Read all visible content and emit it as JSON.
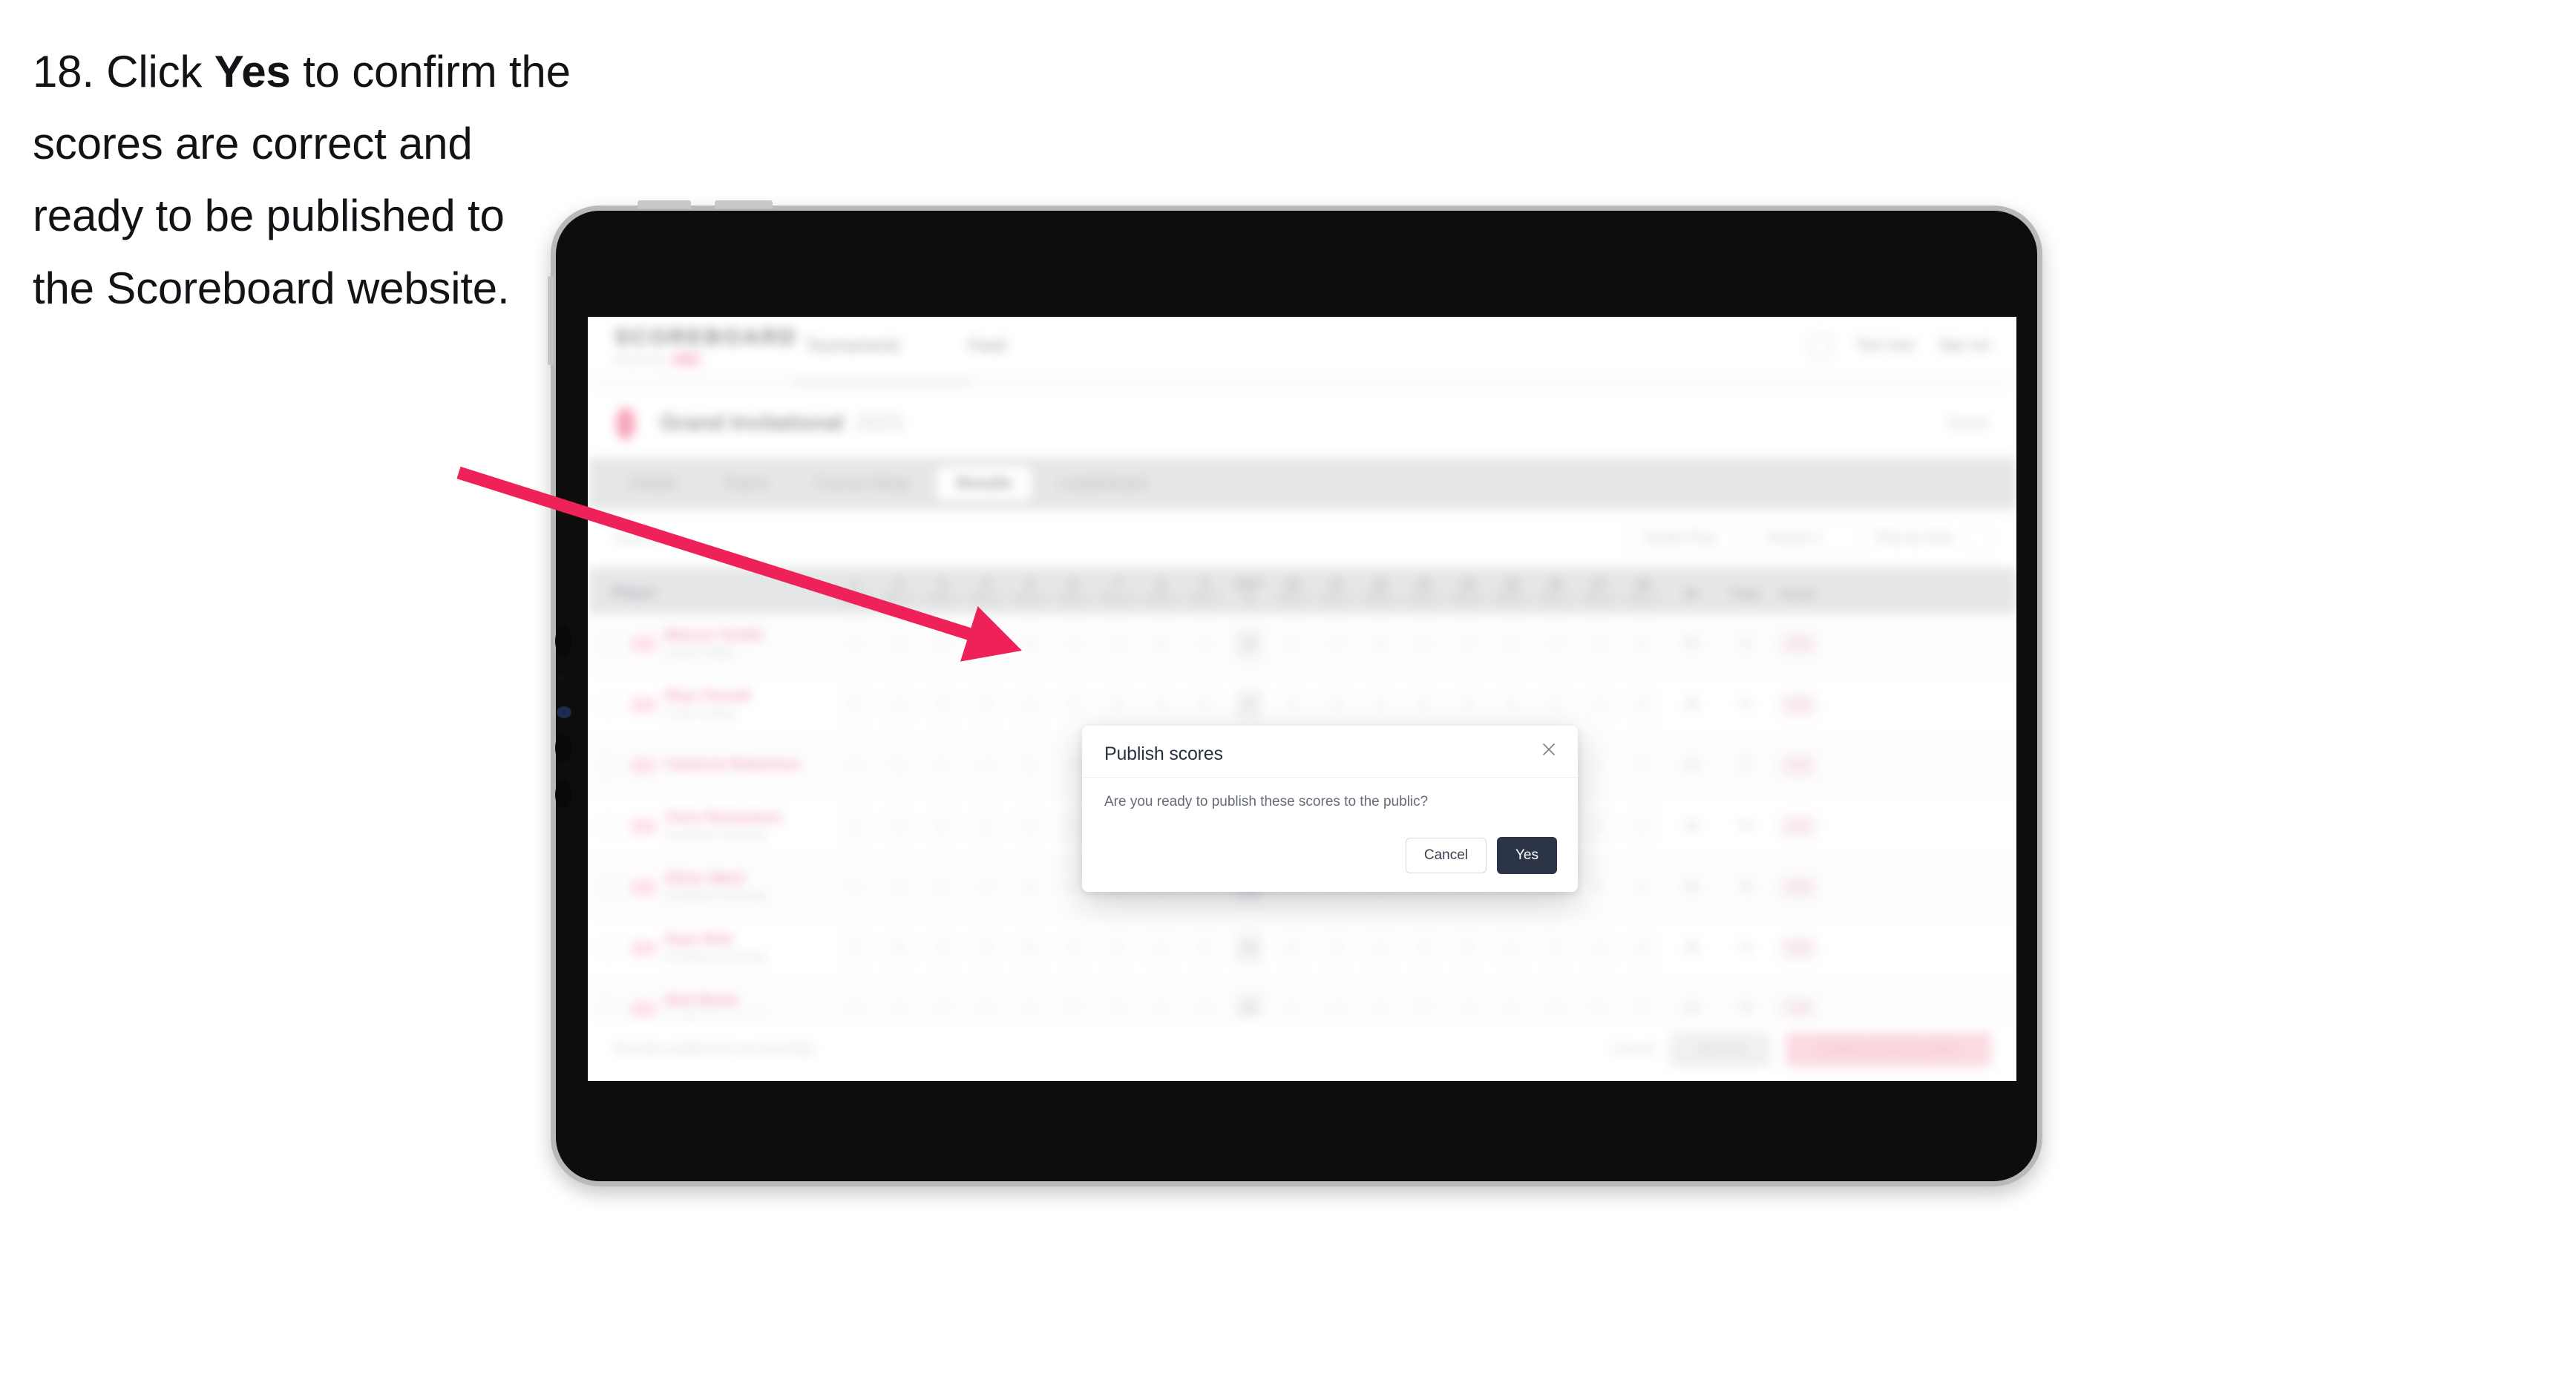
{
  "caption": {
    "prefix": "18. Click ",
    "emphasis": "Yes",
    "suffix": " to confirm the scores are correct and ready to be published to the Scoreboard website."
  },
  "annotation": {
    "type": "arrow",
    "color": "#ee2259",
    "points_to": "yes-button"
  },
  "device": {
    "kind": "tablet",
    "frame_color": "#0d0d0d",
    "bezel_color": "#b9b9b9"
  },
  "app": {
    "header": {
      "logo": "SCOREBOARD",
      "logo_sub": "Powered by",
      "logo_badge": "XYZ",
      "nav": [
        {
          "label": "Tournaments"
        },
        {
          "label": "Feed"
        }
      ],
      "user_name": "Test User",
      "sign_out": "Sign out"
    },
    "event": {
      "name": "Grand Invitational",
      "year": "2023",
      "right_action": "Event"
    },
    "tabs": [
      {
        "label": "Details",
        "active": false
      },
      {
        "label": "Teams",
        "active": false
      },
      {
        "label": "Course Setup",
        "active": false
      },
      {
        "label": "Results",
        "active": true
      },
      {
        "label": "Leaderboard",
        "active": false
      }
    ],
    "filters": {
      "search_placeholder": "Search",
      "round_select": "Round 1",
      "view_select": "Stroke Play",
      "play_select": "Play by hole"
    },
    "table": {
      "player_header": "Player",
      "hole_headers": [
        {
          "num": "1",
          "par": "PAR 4"
        },
        {
          "num": "2",
          "par": "PAR 4"
        },
        {
          "num": "3",
          "par": "PAR 3"
        },
        {
          "num": "4",
          "par": "PAR 5"
        },
        {
          "num": "5",
          "par": "PAR 4"
        },
        {
          "num": "6",
          "par": "PAR 4"
        },
        {
          "num": "7",
          "par": "PAR 3"
        },
        {
          "num": "8",
          "par": "PAR 4"
        },
        {
          "num": "9",
          "par": "PAR 5"
        },
        {
          "num": "OUT",
          "par": "36"
        },
        {
          "num": "10",
          "par": "PAR 4"
        },
        {
          "num": "11",
          "par": "PAR 4"
        },
        {
          "num": "12",
          "par": "PAR 3"
        },
        {
          "num": "13",
          "par": "PAR 5"
        },
        {
          "num": "14",
          "par": "PAR 4"
        },
        {
          "num": "15",
          "par": "PAR 4"
        },
        {
          "num": "16",
          "par": "PAR 3"
        },
        {
          "num": "17",
          "par": "PAR 4"
        },
        {
          "num": "18",
          "par": "PAR 5"
        }
      ],
      "tail_headers": [
        "IN",
        "Total",
        "Score"
      ],
      "rows": [
        {
          "name": "Marcus Tomlin",
          "team": "Coast College",
          "scores": [
            "4",
            "4",
            "3",
            "4",
            "5",
            "4",
            "3",
            "5",
            "4",
            "36",
            "4",
            "4",
            "3",
            "5",
            "4",
            "4",
            "3",
            "4",
            "5"
          ],
          "in": "36",
          "total": "72",
          "score": "+0"
        },
        {
          "name": "Rhys Parnell",
          "team": "Coast College",
          "scores": [
            "5",
            "4",
            "3",
            "4",
            "4",
            "5",
            "3",
            "4",
            "5",
            "37",
            "4",
            "5",
            "3",
            "5",
            "4",
            "4",
            "4",
            "4",
            "5"
          ],
          "in": "38",
          "total": "75",
          "score": "+3"
        },
        {
          "name": "Cameron Robertson",
          "team": "",
          "scores": [
            "4",
            "5",
            "4",
            "4",
            "5",
            "4",
            "3",
            "4",
            "5",
            "38",
            "5",
            "4",
            "3",
            "5",
            "5",
            "4",
            "3",
            "5",
            "5"
          ],
          "in": "39",
          "total": "77",
          "score": "+5"
        },
        {
          "name": "Chris Richardson",
          "team": "Southland University",
          "scores": [
            "4",
            "4",
            "3",
            "5",
            "4",
            "4",
            "3",
            "4",
            "5",
            "36",
            "4",
            "4",
            "4",
            "5",
            "4",
            "5",
            "3",
            "4",
            "5"
          ],
          "in": "38",
          "total": "74",
          "score": "+2"
        },
        {
          "name": "Oliver Ward",
          "team": "Southland University",
          "scores": [
            "5",
            "4",
            "4",
            "4",
            "4",
            "4",
            "3",
            "5",
            "5",
            "38",
            "4",
            "5",
            "3",
            "5",
            "4",
            "4",
            "3",
            "5",
            "5"
          ],
          "in": "38",
          "total": "76",
          "score": "+4"
        },
        {
          "name": "Ryan Britt",
          "team": "Southland University",
          "scores": [
            "4",
            "5",
            "3",
            "4",
            "5",
            "4",
            "4",
            "4",
            "5",
            "38",
            "5",
            "4",
            "3",
            "4",
            "5",
            "4",
            "4",
            "4",
            "5"
          ],
          "in": "38",
          "total": "76",
          "score": "+4"
        },
        {
          "name": "Nick Burke",
          "team": "Southland University",
          "scores": [
            "5",
            "4",
            "3",
            "5",
            "4",
            "5",
            "3",
            "4",
            "5",
            "38",
            "4",
            "4",
            "4",
            "5",
            "4",
            "4",
            "3",
            "5",
            "5"
          ],
          "in": "38",
          "total": "76",
          "score": "+4"
        }
      ]
    },
    "footer": {
      "note": "Results published successfully",
      "cancel": "Cancel",
      "save": "Save all",
      "publish": "Publish scores to public"
    }
  },
  "modal": {
    "title": "Publish scores",
    "message": "Are you ready to publish these scores to the public?",
    "cancel_label": "Cancel",
    "confirm_label": "Yes",
    "close_icon": "close-icon"
  }
}
